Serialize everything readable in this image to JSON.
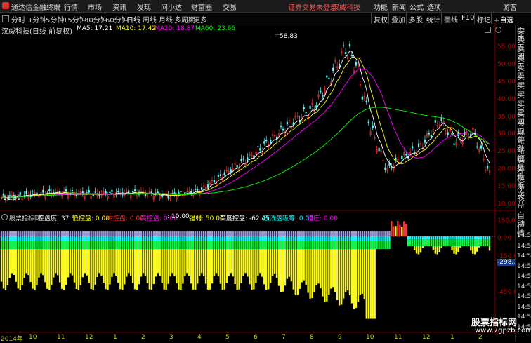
{
  "menubar": {
    "app_title": "通达信金融终端",
    "menus": [
      "行情",
      "市场",
      "资讯",
      "发现",
      "问小达",
      "财富圈",
      "交易"
    ],
    "login_status": "证券交易未登录",
    "stock_name": "汉威科技",
    "right_menus": [
      "功能",
      "新闻",
      "公式",
      "选项",
      "游客"
    ]
  },
  "toolbar": {
    "periods": [
      "分时",
      "1分钟",
      "5分钟",
      "15分钟",
      "30分钟",
      "60分钟",
      "日线",
      "周线",
      "月线",
      "多周期",
      "更多"
    ],
    "active_period": "日线",
    "right_buttons": [
      "复权",
      "叠加",
      "多股",
      "统计",
      "画线",
      "F10",
      "标记",
      "+自选"
    ]
  },
  "main_chart": {
    "title": "汉威科技(日线 前复权)",
    "ma_labels": [
      {
        "text": "MA5: 17.21",
        "color": "#ffffff"
      },
      {
        "text": "MA10: 17.42",
        "color": "#ffff00"
      },
      {
        "text": "MA20: 18.87",
        "color": "#ff00ff"
      },
      {
        "text": "MA60: 23.66",
        "color": "#00ff00"
      }
    ],
    "high_label": "58.83",
    "low_label": "11.39",
    "y_ticks": [
      "55.00",
      "50.00",
      "45.00",
      "40.00",
      "35.00",
      "30.00",
      "25.00",
      "20.00",
      "15.00",
      "10.00"
    ]
  },
  "indicator": {
    "name": "股票指标网",
    "items": [
      {
        "text": "控盘度: 37.51",
        "color": "#ffffff"
      },
      {
        "text": "低控盘: 0.00",
        "color": "#ffff00"
      },
      {
        "text": "中控盘: 0.00",
        "color": "#ff3030"
      },
      {
        "text": "高控盘: 0.00",
        "color": "#ff00ff"
      },
      {
        "text": ": 10.00",
        "color": "#ffffff"
      },
      {
        "text": "强弱: 50.00",
        "color": "#ffff00"
      },
      {
        "text": "高度控盘: -62.45",
        "color": "#ffffff"
      },
      {
        "text": "庄洗盘吸筹: 0.00",
        "color": "#00ffff"
      },
      {
        "text": "强庄: 0.00",
        "color": "#ff00ff"
      }
    ],
    "y_ticks": [
      "150.00",
      "0.00",
      "-150.00",
      "-298.15",
      "-450.00"
    ]
  },
  "x_axis": [
    "2014年",
    "10",
    "11",
    "12",
    "1",
    "2",
    "3",
    "4",
    "5",
    "6",
    "7",
    "8",
    "9",
    "10",
    "11",
    "12",
    "1",
    "2"
  ],
  "right_panel": {
    "items": [
      "委比",
      "卖五",
      "卖四",
      "卖三",
      "卖二",
      "卖一",
      "买一",
      "买二",
      "买三",
      "买四",
      "买五",
      "现价",
      "涨跌",
      "涨幅",
      "总量",
      "外盘",
      "换手",
      "净资",
      "收益"
    ],
    "lower_items": [
      "自动",
      "行情",
      "14:56",
      "14:56",
      "14:56",
      "14:56",
      "14:56",
      "14:56",
      "14:56",
      "14:56",
      "14:56",
      "14:56"
    ]
  },
  "watermark": {
    "line1": "股票指标网",
    "line2": "www.7gpzb.com"
  },
  "colors": {
    "up": "#ff3232",
    "down": "#54ffff",
    "ma5": "#ffffff",
    "ma10": "#ffff00",
    "ma20": "#ff00ff",
    "ma60": "#00ff00",
    "bar_yellow": "#ffff00",
    "bar_green": "#00ff40",
    "bar_cyan": "#00ffff",
    "bar_lavender": "#9b96d8"
  }
}
